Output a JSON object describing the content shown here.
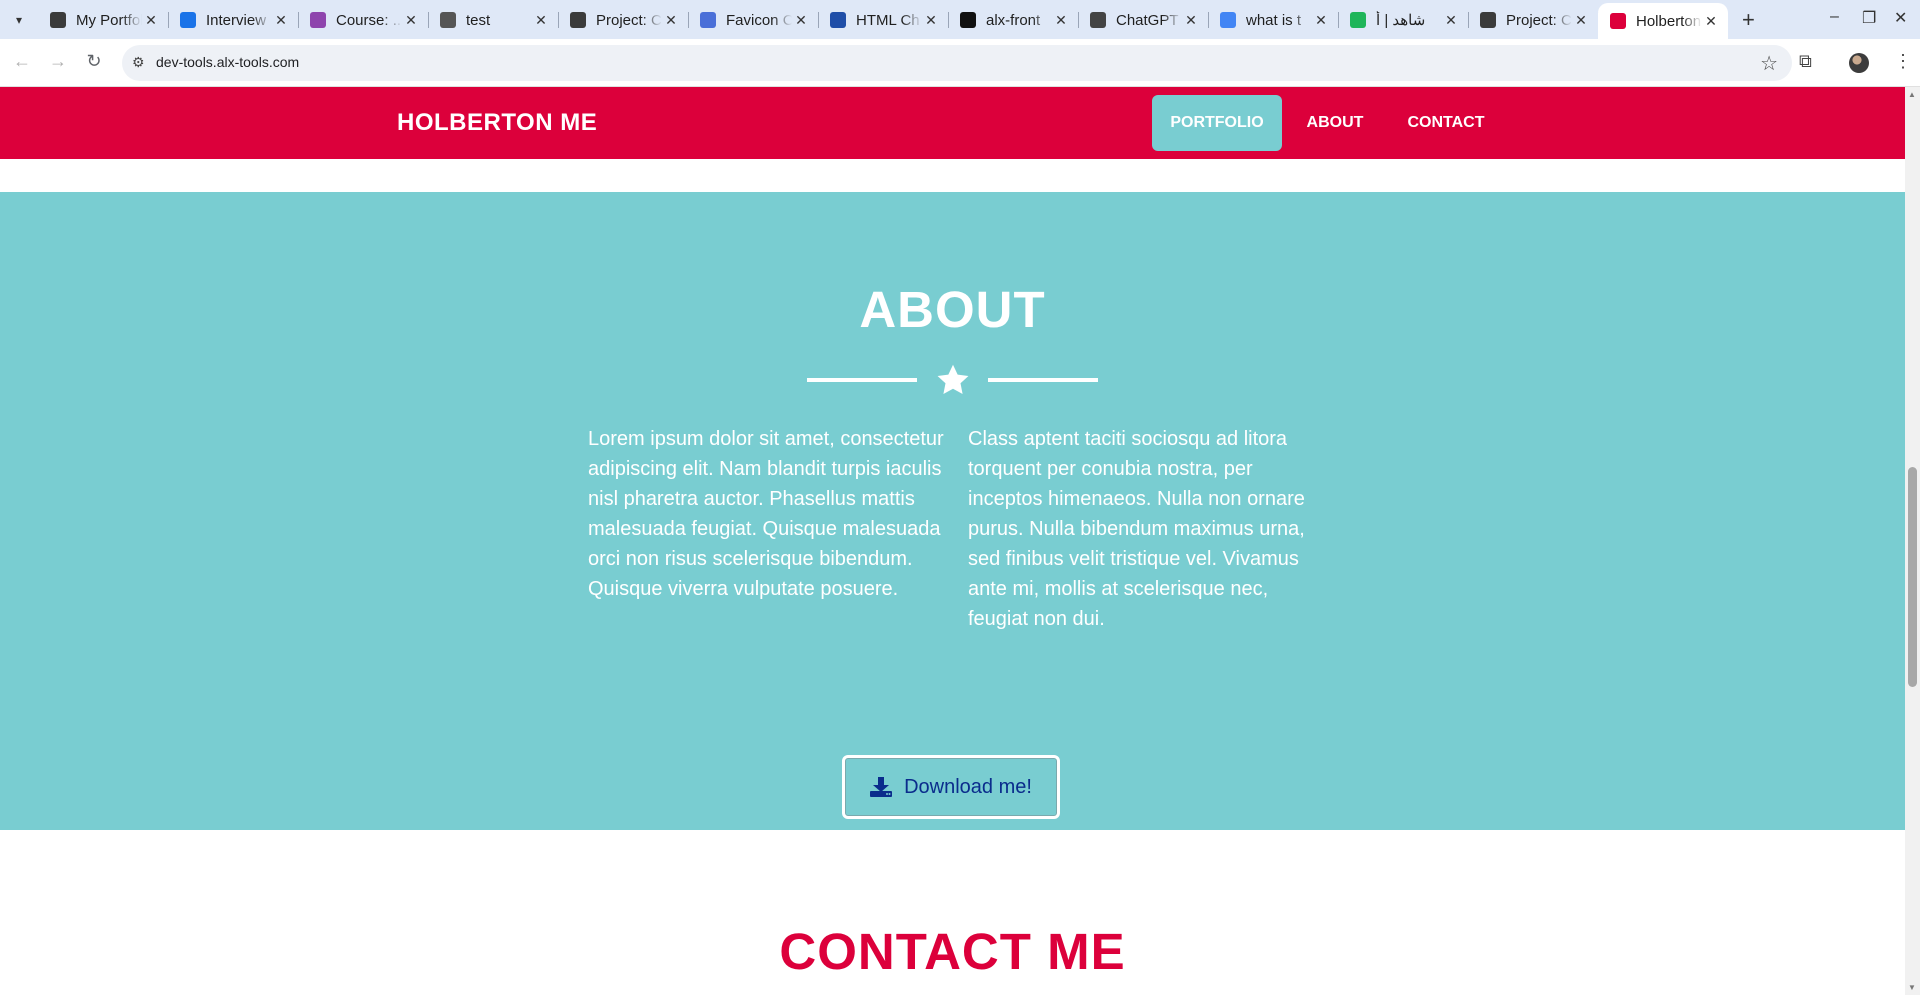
{
  "browser": {
    "tabs": [
      {
        "title": "My Portfolio",
        "favicon": "alx-icon",
        "color": "#3b3b3b"
      },
      {
        "title": "Interview",
        "favicon": "c-icon",
        "color": "#1a73e8"
      },
      {
        "title": "Course: ...",
        "favicon": "course-icon",
        "color": "#8e44ad"
      },
      {
        "title": "test",
        "favicon": "globe-icon",
        "color": "#555555"
      },
      {
        "title": "Project: C",
        "favicon": "alx-icon",
        "color": "#3b3b3b"
      },
      {
        "title": "Favicon C",
        "favicon": "r-icon",
        "color": "#4a6fd8"
      },
      {
        "title": "HTML Ch",
        "favicon": "html-icon",
        "color": "#1f4ea8"
      },
      {
        "title": "alx-front",
        "favicon": "github-icon",
        "color": "#111111"
      },
      {
        "title": "ChatGPT",
        "favicon": "chatgpt-icon",
        "color": "#444444"
      },
      {
        "title": "what is t",
        "favicon": "google-icon",
        "color": "#4285f4"
      },
      {
        "title": "شاهد | أ",
        "favicon": "shahid-icon",
        "color": "#1fb55a"
      },
      {
        "title": "Project: C",
        "favicon": "alx-icon",
        "color": "#3b3b3b"
      },
      {
        "title": "Holberton",
        "favicon": "holberton-icon",
        "color": "#dc003b",
        "active": true
      }
    ],
    "url": "dev-tools.alx-tools.com"
  },
  "site": {
    "brand": "HOLBERTON ME",
    "nav": [
      "PORTFOLIO",
      "ABOUT",
      "CONTACT"
    ],
    "active_nav": "PORTFOLIO",
    "colors": {
      "primary": "#dc003b",
      "teal": "#79cdd1",
      "white": "#ffffff",
      "button_text": "#0a2c8c"
    }
  },
  "about": {
    "title": "ABOUT",
    "col1": "Lorem ipsum dolor sit amet, consectetur adipiscing elit. Nam blandit turpis iaculis nisl pharetra auctor. Phasellus mattis malesuada feugiat. Quisque malesuada orci non risus scelerisque bibendum. Quisque viverra vulputate posuere.",
    "col2": "Class aptent taciti sociosqu ad litora torquent per conubia nostra, per inceptos himenaeos. Nulla non ornare purus. Nulla bibendum maximus urna, sed finibus velit tristique vel. Vivamus ante mi, mollis at scelerisque nec, feugiat non dui.",
    "button": "Download me!"
  },
  "contact": {
    "title": "CONTACT ME"
  }
}
